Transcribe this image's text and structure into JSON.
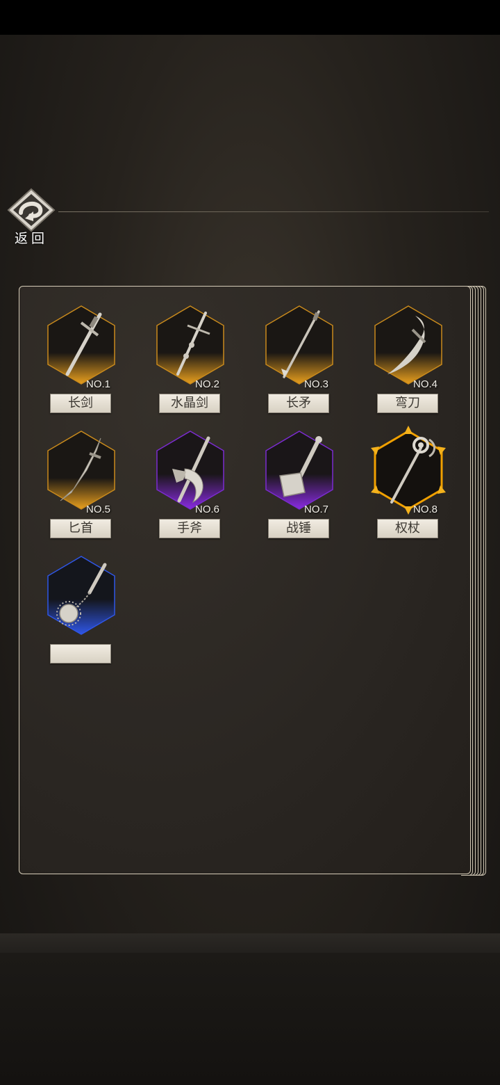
{
  "header": {
    "back_label": "返回"
  },
  "weapons": [
    {
      "no": "NO.1",
      "name": "长剑",
      "rarity": "gold",
      "icon": "long-sword-icon"
    },
    {
      "no": "NO.2",
      "name": "水晶剑",
      "rarity": "gold",
      "icon": "crystal-sword-icon"
    },
    {
      "no": "NO.3",
      "name": "长矛",
      "rarity": "gold",
      "icon": "spear-icon"
    },
    {
      "no": "NO.4",
      "name": "弯刀",
      "rarity": "gold",
      "icon": "scimitar-icon"
    },
    {
      "no": "NO.5",
      "name": "匕首",
      "rarity": "gold",
      "icon": "dagger-icon"
    },
    {
      "no": "NO.6",
      "name": "手斧",
      "rarity": "purple",
      "icon": "hand-axe-icon"
    },
    {
      "no": "NO.7",
      "name": "战锤",
      "rarity": "purple",
      "icon": "war-hammer-icon"
    },
    {
      "no": "NO.8",
      "name": "权杖",
      "rarity": "legendary",
      "icon": "scepter-icon"
    },
    {
      "no": "",
      "name": "",
      "rarity": "blue",
      "icon": "flail-icon"
    }
  ],
  "colors": {
    "gold": "#e9a01e",
    "purple": "#8a2be2",
    "blue": "#2f56e6",
    "legendary": "#f0a000",
    "plate": "#e8e2d6",
    "panel_border": "#d6ccb8"
  }
}
